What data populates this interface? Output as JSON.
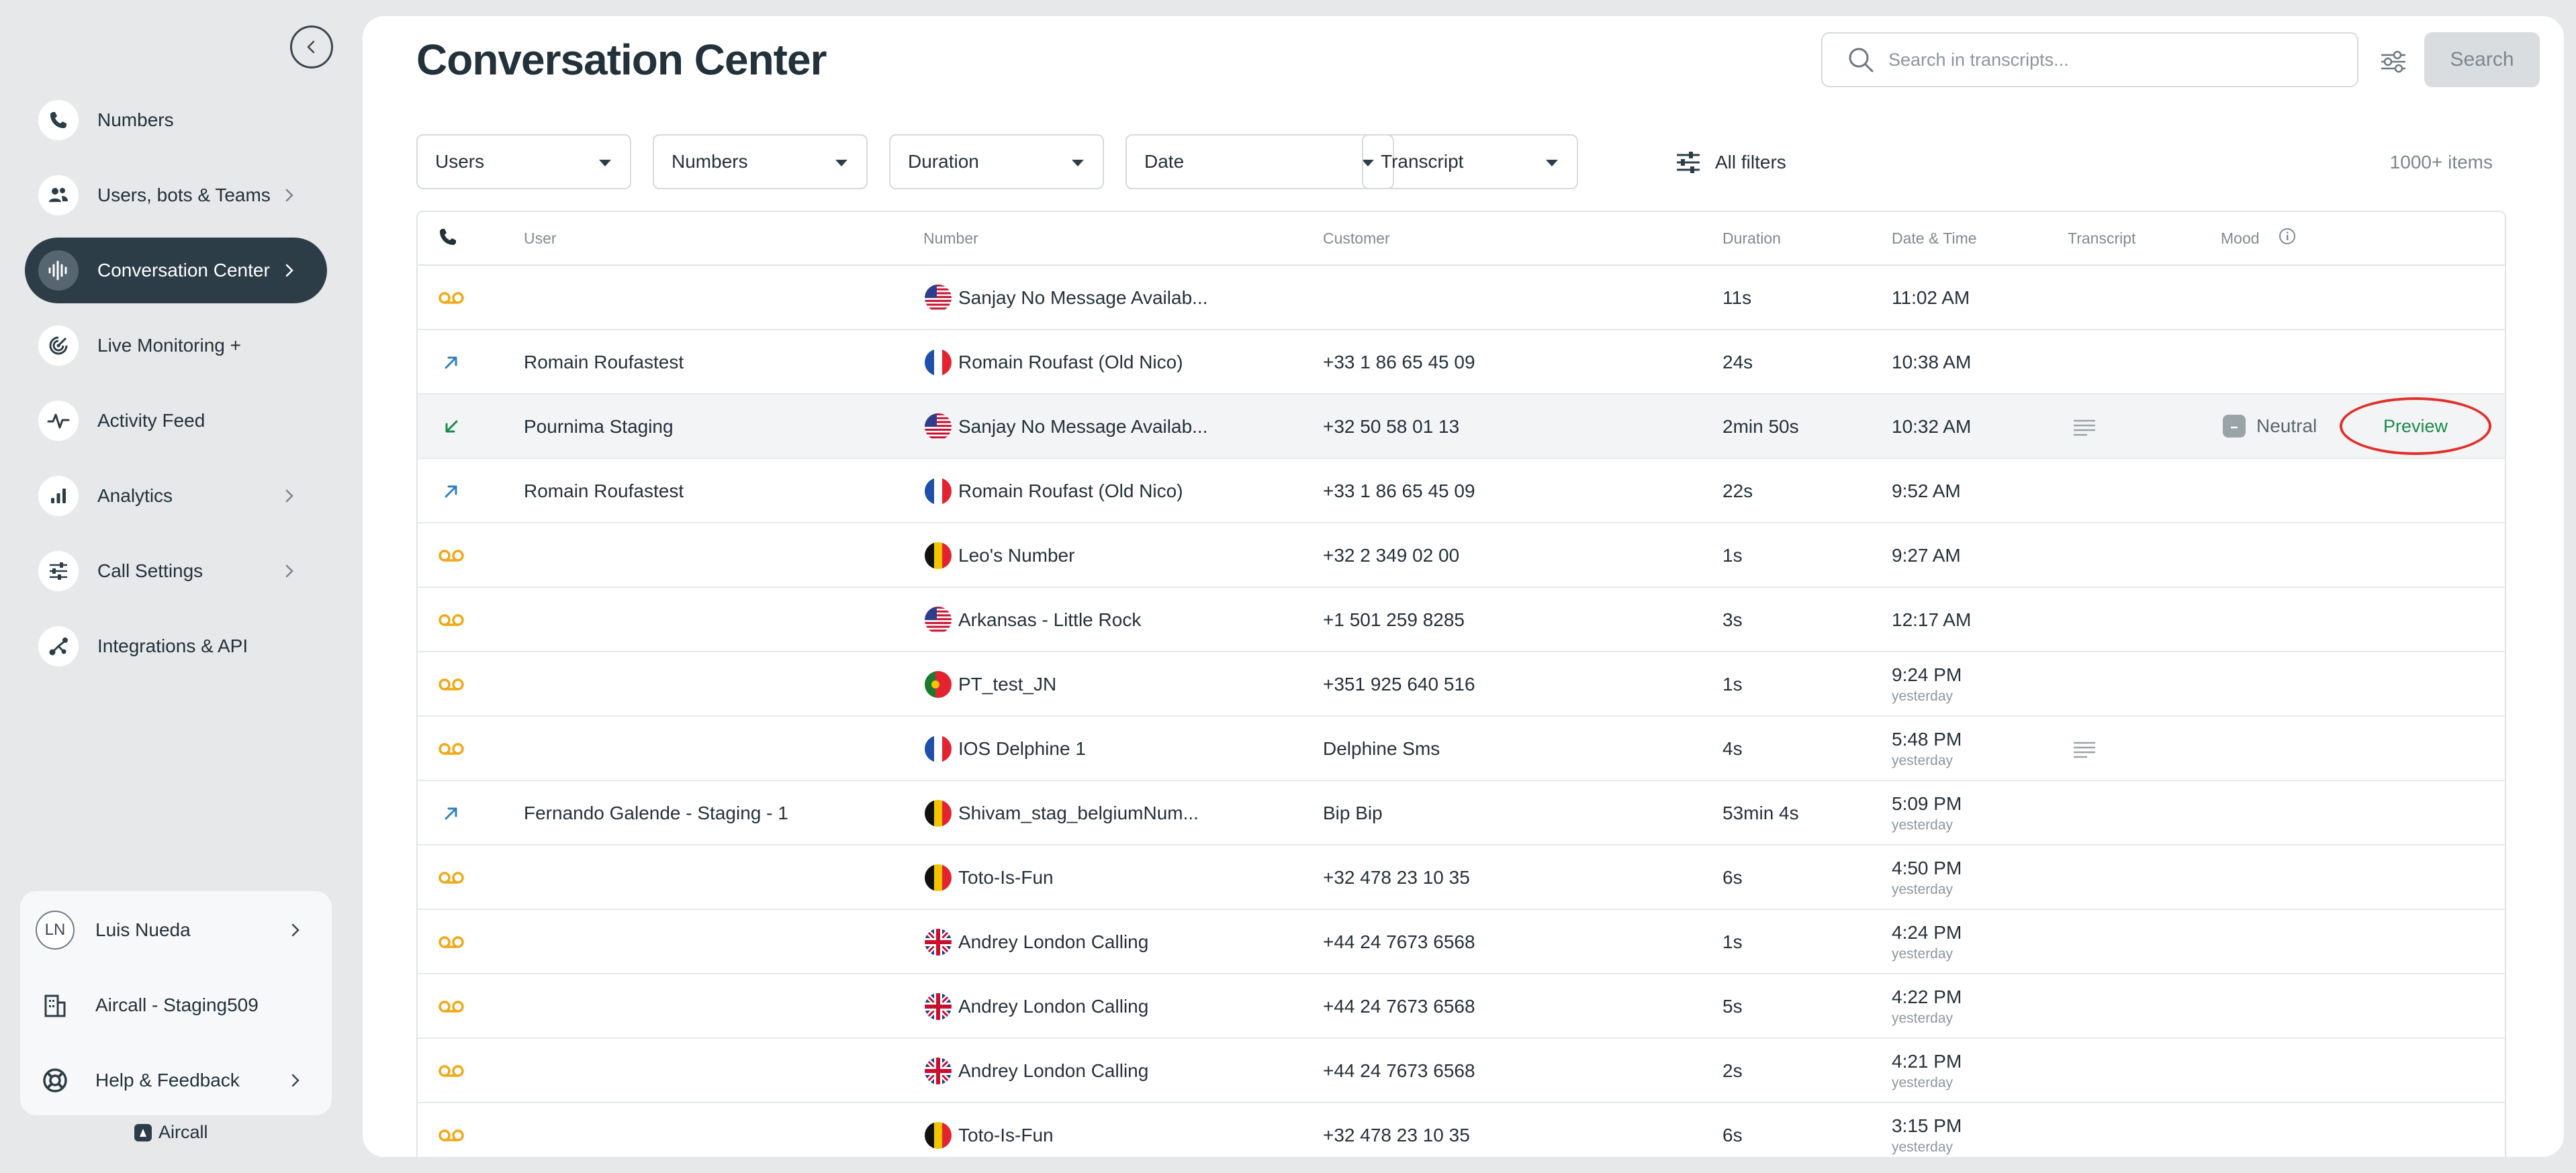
{
  "sidebar": {
    "nav": [
      {
        "label": "Numbers",
        "icon": "phone-icon",
        "chevron": false,
        "active": false
      },
      {
        "label": "Users, bots & Teams",
        "icon": "users-icon",
        "chevron": true,
        "active": false
      },
      {
        "label": "Conversation Center",
        "icon": "soundwave-icon",
        "chevron": true,
        "active": true
      },
      {
        "label": "Live Monitoring +",
        "icon": "radar-icon",
        "chevron": false,
        "active": false
      },
      {
        "label": "Activity Feed",
        "icon": "pulse-icon",
        "chevron": false,
        "active": false
      },
      {
        "label": "Analytics",
        "icon": "bar-chart-icon",
        "chevron": true,
        "active": false
      },
      {
        "label": "Call Settings",
        "icon": "sliders-icon",
        "chevron": true,
        "active": false
      },
      {
        "label": "Integrations & API",
        "icon": "integrations-icon",
        "chevron": false,
        "active": false
      }
    ],
    "user": {
      "initials": "LN",
      "name": "Luis Nueda"
    },
    "company": "Aircall - Staging509",
    "help": "Help & Feedback",
    "brand": "Aircall"
  },
  "header": {
    "title": "Conversation Center",
    "search_placeholder": "Search in transcripts...",
    "search_button": "Search"
  },
  "filters": [
    "Users",
    "Numbers",
    "Duration",
    "Date",
    "Transcript"
  ],
  "all_filters_label": "All filters",
  "items_count": "1000+ items",
  "table": {
    "columns": [
      "User",
      "Number",
      "Customer",
      "Duration",
      "Date & Time",
      "Transcript",
      "Mood"
    ],
    "rows": [
      {
        "type": "voicemail",
        "user": "",
        "flag": "us",
        "number": "Sanjay No Message Availab...",
        "customer": "",
        "duration": "11s",
        "time": "11:02 AM",
        "day": "",
        "transcript": false
      },
      {
        "type": "outbound",
        "user": "Romain Roufastest",
        "flag": "fr",
        "number": "Romain Roufast (Old Nico)",
        "customer": "+33 1 86 65 45 09",
        "duration": "24s",
        "time": "10:38 AM",
        "day": "",
        "transcript": false
      },
      {
        "type": "inbound",
        "user": "Pournima Staging",
        "flag": "us",
        "number": "Sanjay No Message Availab...",
        "customer": "+32 50 58 01 13",
        "duration": "2min 50s",
        "time": "10:32 AM",
        "day": "",
        "transcript": true,
        "mood": "Neutral",
        "action": "Preview"
      },
      {
        "type": "outbound",
        "user": "Romain Roufastest",
        "flag": "fr",
        "number": "Romain Roufast (Old Nico)",
        "customer": "+33 1 86 65 45 09",
        "duration": "22s",
        "time": "9:52 AM",
        "day": "",
        "transcript": false
      },
      {
        "type": "voicemail",
        "user": "",
        "flag": "be",
        "number": "Leo's Number",
        "customer": "+32 2 349 02 00",
        "duration": "1s",
        "time": "9:27 AM",
        "day": "",
        "transcript": false
      },
      {
        "type": "voicemail",
        "user": "",
        "flag": "us",
        "number": "Arkansas - Little Rock",
        "customer": "+1 501 259 8285",
        "duration": "3s",
        "time": "12:17 AM",
        "day": "",
        "transcript": false
      },
      {
        "type": "voicemail",
        "user": "",
        "flag": "pt",
        "number": "PT_test_JN",
        "customer": "+351 925 640 516",
        "duration": "1s",
        "time": "9:24 PM",
        "day": "yesterday",
        "transcript": false
      },
      {
        "type": "voicemail",
        "user": "",
        "flag": "fr",
        "number": "IOS Delphine 1",
        "customer": "Delphine Sms",
        "duration": "4s",
        "time": "5:48 PM",
        "day": "yesterday",
        "transcript": true
      },
      {
        "type": "outbound",
        "user": "Fernando Galende - Staging - 1",
        "flag": "be",
        "number": "Shivam_stag_belgiumNum...",
        "customer": "Bip Bip",
        "duration": "53min 4s",
        "time": "5:09 PM",
        "day": "yesterday",
        "transcript": false
      },
      {
        "type": "voicemail",
        "user": "",
        "flag": "be",
        "number": "Toto-Is-Fun",
        "customer": "+32 478 23 10 35",
        "duration": "6s",
        "time": "4:50 PM",
        "day": "yesterday",
        "transcript": false
      },
      {
        "type": "voicemail",
        "user": "",
        "flag": "gb",
        "number": "Andrey London Calling",
        "customer": "+44 24 7673 6568",
        "duration": "1s",
        "time": "4:24 PM",
        "day": "yesterday",
        "transcript": false
      },
      {
        "type": "voicemail",
        "user": "",
        "flag": "gb",
        "number": "Andrey London Calling",
        "customer": "+44 24 7673 6568",
        "duration": "5s",
        "time": "4:22 PM",
        "day": "yesterday",
        "transcript": false
      },
      {
        "type": "voicemail",
        "user": "",
        "flag": "gb",
        "number": "Andrey London Calling",
        "customer": "+44 24 7673 6568",
        "duration": "2s",
        "time": "4:21 PM",
        "day": "yesterday",
        "transcript": false
      },
      {
        "type": "voicemail",
        "user": "",
        "flag": "be",
        "number": "Toto-Is-Fun",
        "customer": "+32 478 23 10 35",
        "duration": "6s",
        "time": "3:15 PM",
        "day": "yesterday",
        "transcript": false
      }
    ]
  },
  "colors": {
    "sidebar_active": "#2d3d47",
    "voicemail": "#f0a818",
    "call_direction": "#2f7fc1",
    "preview_text": "#1b8a4c",
    "preview_highlight": "#e0302a"
  }
}
